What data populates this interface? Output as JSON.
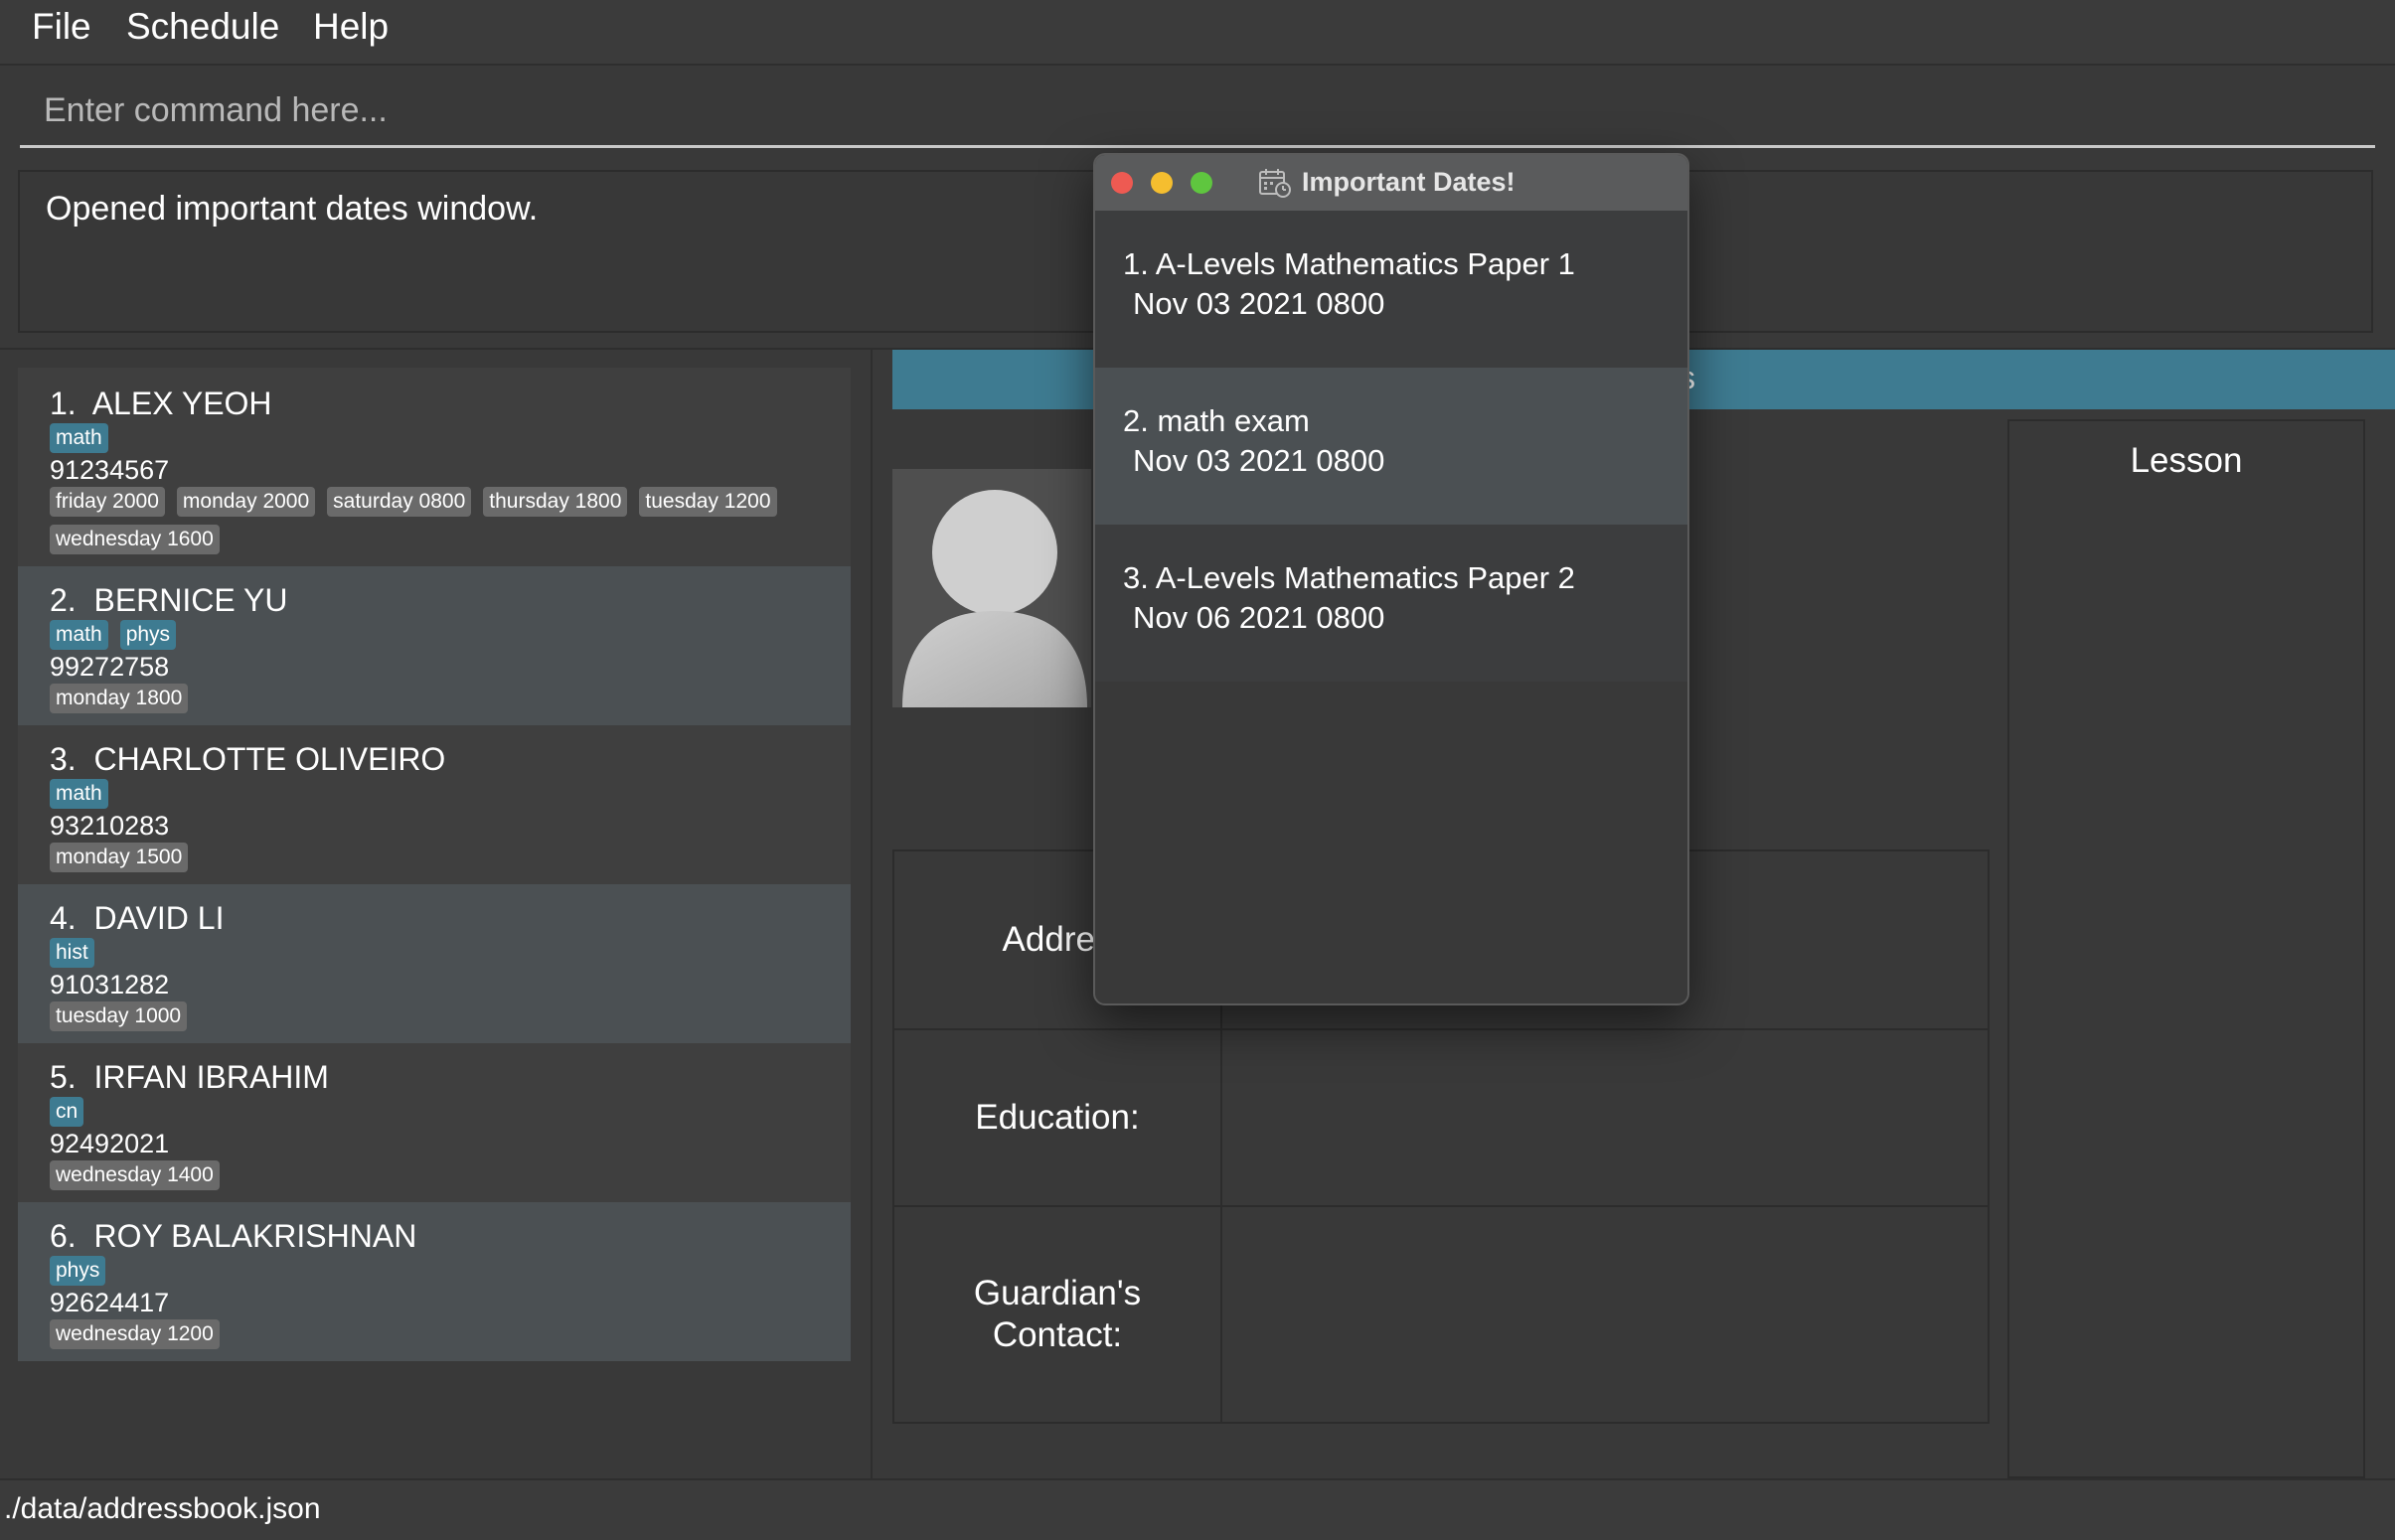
{
  "menu": {
    "file": "File",
    "schedule": "Schedule",
    "help": "Help"
  },
  "command": {
    "placeholder": "Enter command here...",
    "value": ""
  },
  "result": {
    "text": "Opened important dates window."
  },
  "persons": [
    {
      "index": "1.",
      "name": "ALEX YEOH",
      "subjects": [
        "math"
      ],
      "phone": "91234567",
      "times": [
        "friday 2000",
        "monday 2000",
        "saturday 0800",
        "thursday 1800",
        "tuesday 1200",
        "wednesday 1600"
      ]
    },
    {
      "index": "2.",
      "name": "BERNICE YU",
      "subjects": [
        "math",
        "phys"
      ],
      "phone": "99272758",
      "times": [
        "monday 1800"
      ]
    },
    {
      "index": "3.",
      "name": "CHARLOTTE OLIVEIRO",
      "subjects": [
        "math"
      ],
      "phone": "93210283",
      "times": [
        "monday 1500"
      ]
    },
    {
      "index": "4.",
      "name": "DAVID LI",
      "subjects": [
        "hist"
      ],
      "phone": "91031282",
      "times": [
        "tuesday 1000"
      ]
    },
    {
      "index": "5.",
      "name": "IRFAN IBRAHIM",
      "subjects": [
        "cn"
      ],
      "phone": "92492021",
      "times": [
        "wednesday 1400"
      ]
    },
    {
      "index": "6.",
      "name": "ROY BALAKRISHNAN",
      "subjects": [
        "phys"
      ],
      "phone": "92624417",
      "times": [
        "wednesday 1200"
      ]
    }
  ],
  "detail": {
    "header_visible": "s",
    "lesson_title": "Lesson",
    "address_label": "Addres",
    "education_label": "Education:",
    "guardian_label_1": "Guardian's",
    "guardian_label_2": "Contact:"
  },
  "status": {
    "path": "./data/addressbook.json"
  },
  "popup": {
    "title": "Important Dates!",
    "items": [
      {
        "name": "1.  A-Levels Mathematics Paper 1",
        "when": "Nov 03 2021 0800"
      },
      {
        "name": "2.  math exam",
        "when": "Nov 03 2021 0800"
      },
      {
        "name": "3.  A-Levels Mathematics Paper 2",
        "when": "Nov 06 2021 0800"
      }
    ]
  },
  "colors": {
    "accent": "#3e7b91",
    "background": "#393939",
    "tag_time": "#6a6a6a",
    "row_alt": "#4b5053"
  },
  "icons": {
    "popup": "calendar-clock-icon",
    "avatar": "default-user-avatar-icon"
  }
}
